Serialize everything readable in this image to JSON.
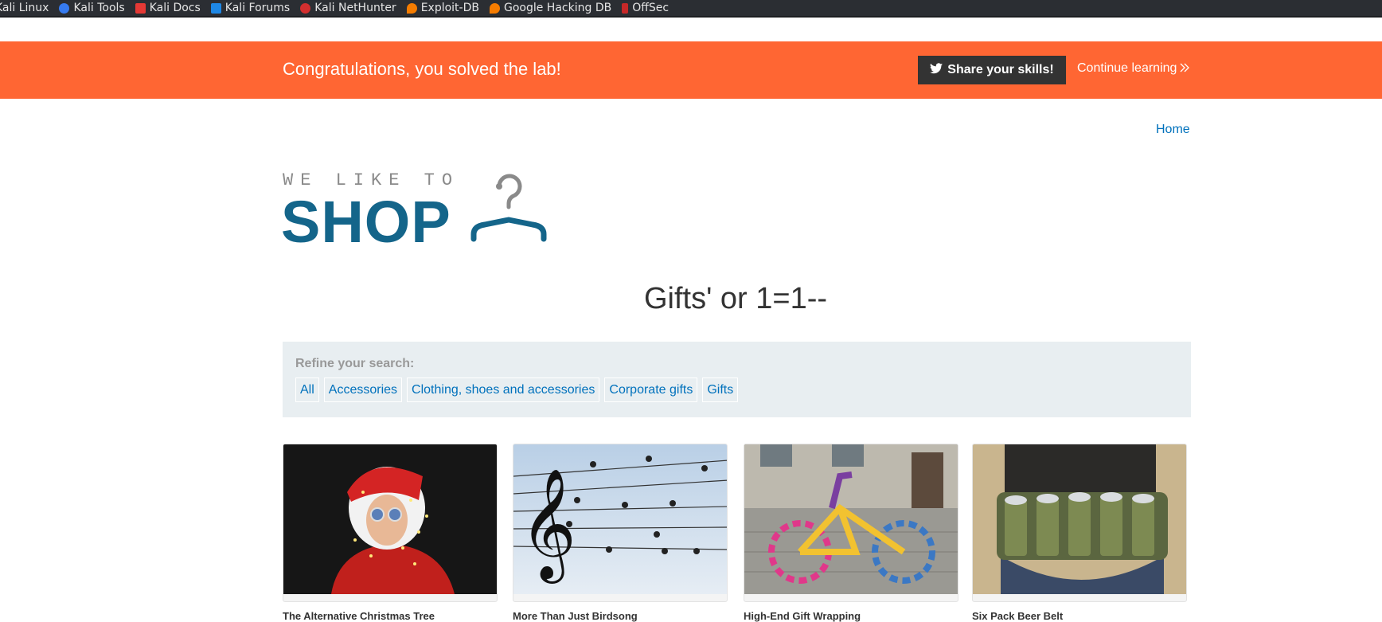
{
  "bookmarks": [
    {
      "label": "Kali Linux",
      "icon": "kali-linux-icon",
      "color": "#2b2e33"
    },
    {
      "label": "Kali Tools",
      "icon": "kali-tools-icon",
      "color": "#367bf0"
    },
    {
      "label": "Kali Docs",
      "icon": "kali-docs-icon",
      "color": "#e53935"
    },
    {
      "label": "Kali Forums",
      "icon": "kali-forums-icon",
      "color": "#1e88e5"
    },
    {
      "label": "Kali NetHunter",
      "icon": "kali-nethunter-icon",
      "color": "#d32f2f"
    },
    {
      "label": "Exploit-DB",
      "icon": "exploit-db-icon",
      "color": "#f57c00"
    },
    {
      "label": "Google Hacking DB",
      "icon": "ghdb-icon",
      "color": "#f57c00"
    },
    {
      "label": "OffSec",
      "icon": "offsec-icon",
      "color": "#c62828"
    }
  ],
  "banner": {
    "message": "Congratulations, you solved the lab!",
    "share_label": "Share your skills!",
    "continue_label": "Continue learning",
    "accent": "#ff6633"
  },
  "nav": {
    "home_label": "Home"
  },
  "logo": {
    "tagline": "WE LIKE TO",
    "main": "SHOP"
  },
  "page_title": "Gifts' or 1=1--",
  "filter": {
    "label": "Refine your search:",
    "categories": [
      "All",
      "Accessories",
      "Clothing, shoes and accessories",
      "Corporate gifts",
      "Gifts"
    ]
  },
  "products": [
    {
      "title": "The Alternative Christmas Tree",
      "image": "christmas-tree-image"
    },
    {
      "title": "More Than Just Birdsong",
      "image": "birdsong-image"
    },
    {
      "title": "High-End Gift Wrapping",
      "image": "gift-wrapping-image"
    },
    {
      "title": "Six Pack Beer Belt",
      "image": "beer-belt-image"
    }
  ]
}
